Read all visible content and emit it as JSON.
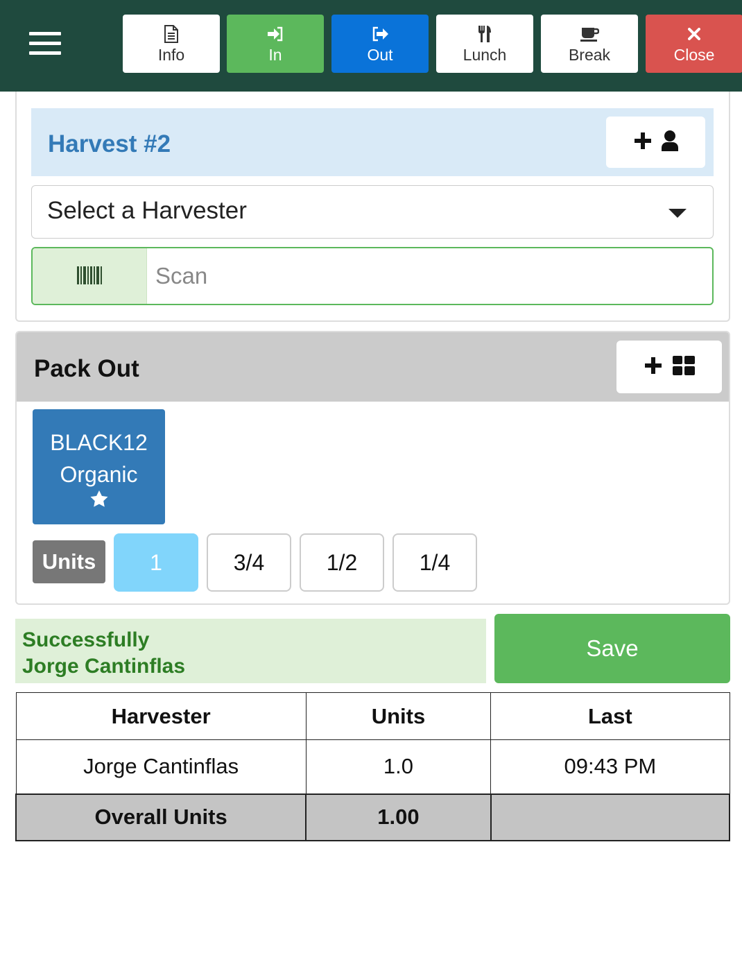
{
  "topbar": {
    "buttons": [
      {
        "label": "Info",
        "icon": "file-icon",
        "style": "white"
      },
      {
        "label": "In",
        "icon": "sign-in-icon",
        "style": "green"
      },
      {
        "label": "Out",
        "icon": "sign-out-icon",
        "style": "blue"
      },
      {
        "label": "Lunch",
        "icon": "cutlery-icon",
        "style": "white"
      },
      {
        "label": "Break",
        "icon": "coffee-icon",
        "style": "white"
      },
      {
        "label": "Close",
        "icon": "close-icon",
        "style": "red"
      }
    ]
  },
  "harvest": {
    "title": "Harvest #2",
    "select_placeholder": "Select a Harvester",
    "scan_placeholder": "Scan"
  },
  "packout": {
    "title": "Pack Out",
    "product": {
      "line1": "BLACK12",
      "line2": "Organic",
      "favorite": true
    },
    "units_label": "Units",
    "unit_options": [
      "1",
      "3/4",
      "1/2",
      "1/4"
    ],
    "selected_unit": "1"
  },
  "status": {
    "line1": "Successfully",
    "line2": "Jorge Cantinflas"
  },
  "save_label": "Save",
  "table": {
    "headers": [
      "Harvester",
      "Units",
      "Last"
    ],
    "rows": [
      {
        "harvester": "Jorge Cantinflas",
        "units": "1.0",
        "last": "09:43 PM"
      }
    ],
    "total": {
      "label": "Overall Units",
      "units": "1.00",
      "last": ""
    }
  },
  "colors": {
    "topbar": "#1f4a3e",
    "in": "#5cb85c",
    "out": "#0a73d9",
    "close": "#d9534f",
    "harvest_title": "#337ab7",
    "product_tile": "#337ab7",
    "selected_unit": "#81d5fb",
    "success_text": "#2d7d24"
  }
}
